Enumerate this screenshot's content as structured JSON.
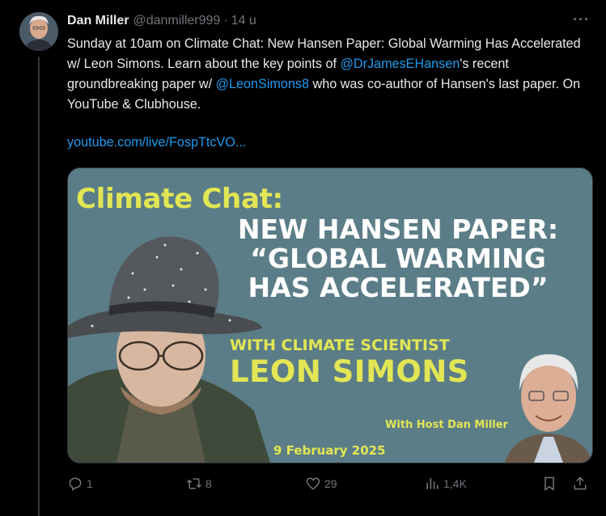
{
  "tweet": {
    "author": {
      "display_name": "Dan Miller",
      "handle": "@danmiller999",
      "separator": "·",
      "time": "14 u"
    },
    "text": {
      "part1": "Sunday at 10am on Climate Chat: New Hansen Paper: Global Warming Has Accelerated w/ Leon Simons. Learn about the key points of ",
      "mention1": "@DrJamesEHansen",
      "part2": "'s recent groundbreaking paper w/ ",
      "mention2": "@LeonSimons8",
      "part3": " who was co-author of Hansen's last paper. On YouTube & Clubhouse.",
      "link": "youtube.com/live/FospTtcVO..."
    },
    "media": {
      "title": "Climate Chat:",
      "headline_line1": "NEW HANSEN PAPER:",
      "headline_line2": "“GLOBAL WARMING",
      "headline_line3": "HAS ACCELERATED”",
      "subtitle": "WITH CLIMATE SCIENTIST",
      "guest_name": "LEON SIMONS",
      "host_label": "With Host Dan Miller",
      "date": "9 February 2025"
    },
    "actions": {
      "replies": "1",
      "reposts": "8",
      "likes": "29",
      "views": "1,4K"
    },
    "more_label": "···"
  },
  "icons": {
    "reply": "reply-icon",
    "repost": "repost-icon",
    "like": "heart-icon",
    "views": "views-icon",
    "bookmark": "bookmark-icon",
    "share": "share-icon",
    "more": "more-icon"
  },
  "colors": {
    "background": "#000000",
    "text": "#e7e9ea",
    "muted": "#71767b",
    "link": "#1d9bf0",
    "media_bg": "#5b7d87",
    "media_yellow": "#e3e654"
  }
}
